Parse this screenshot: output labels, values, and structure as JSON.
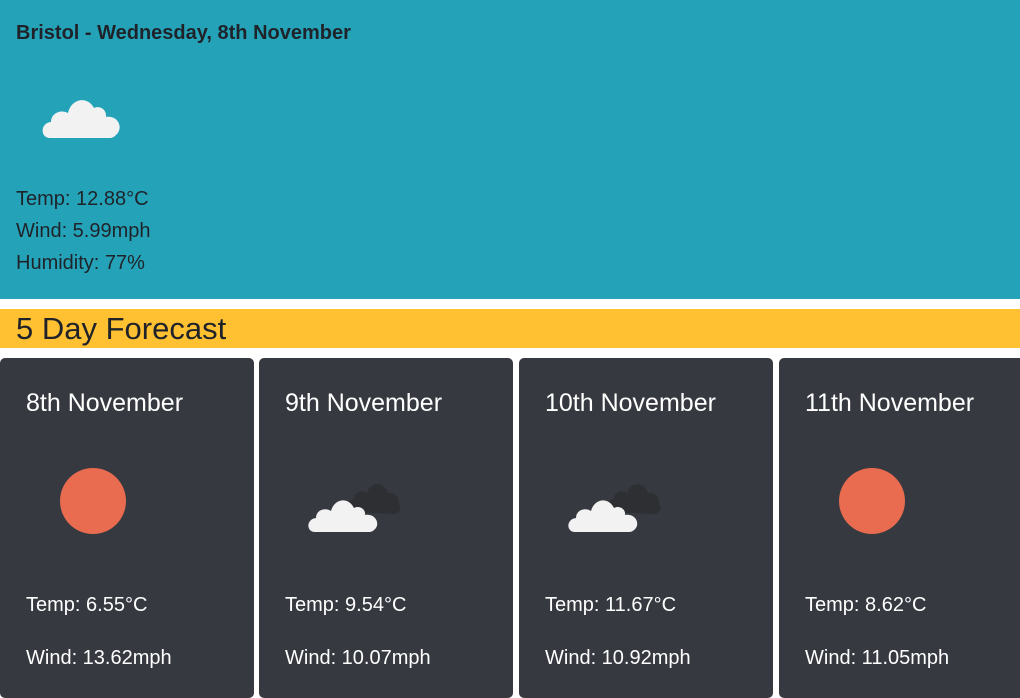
{
  "current": {
    "title": "Bristol - Wednesday, 8th November",
    "icon": "cloud-icon",
    "temp_label": "Temp: 12.88°C",
    "wind_label": "Wind: 5.99mph",
    "humidity_label": "Humidity: 77%"
  },
  "forecast": {
    "heading": "5 Day Forecast",
    "days": [
      {
        "date": "8th November",
        "icon": "sun-icon",
        "temp": "Temp: 6.55°C",
        "wind": "Wind: 13.62mph"
      },
      {
        "date": "9th November",
        "icon": "clouds-icon",
        "temp": "Temp: 9.54°C",
        "wind": "Wind: 10.07mph"
      },
      {
        "date": "10th November",
        "icon": "clouds-icon",
        "temp": "Temp: 11.67°C",
        "wind": "Wind: 10.92mph"
      },
      {
        "date": "11th November",
        "icon": "sun-icon",
        "temp": "Temp: 8.62°C",
        "wind": "Wind: 11.05mph"
      }
    ]
  },
  "colors": {
    "current_bg": "#24a3b8",
    "forecast_header_bg": "#ffc131",
    "card_bg": "#363940",
    "sun": "#e96b50",
    "cloud_light": "#f2f2f2",
    "cloud_dark": "#2d2f33"
  }
}
